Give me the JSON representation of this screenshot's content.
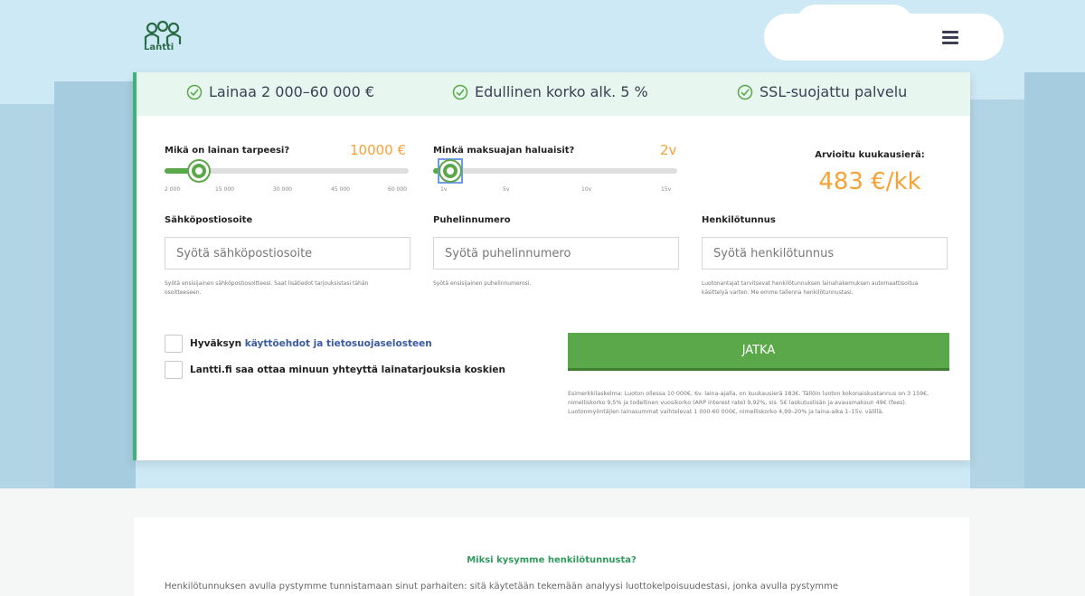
{
  "brand": {
    "name": "Lantti"
  },
  "benefits": [
    {
      "label": "Lainaa 2 000–60 000 €",
      "icon": "check-circle-icon"
    },
    {
      "label": "Edullinen korko alk. 5 %",
      "icon": "check-circle-icon"
    },
    {
      "label": "SSL-suojattu palvelu",
      "icon": "check-circle-icon"
    }
  ],
  "loan_amount": {
    "label": "Mikä on lainan tarpeesi?",
    "value": "10000 €",
    "fraction": 0.14,
    "ticks": [
      "2 000",
      "15 000",
      "30 000",
      "45 000",
      "60 000"
    ]
  },
  "loan_period": {
    "label": "Minkä maksuajan haluaisit?",
    "value": "2v",
    "fraction": 0.07,
    "ticks": [
      "1v",
      "5v",
      "10v",
      "15v"
    ]
  },
  "estimate": {
    "label": "Arvioitu kuukausierä:",
    "value": "483 €/kk"
  },
  "fields": {
    "email": {
      "label": "Sähköpostiosoite",
      "placeholder": "Syötä sähköpostiosoite",
      "help": "Syötä ensisijainen sähköpostiosoitteesi. Saat lisätiedot tarjouksistasi tähän osoitteeseen."
    },
    "phone": {
      "label": "Puhelinnumero",
      "placeholder": "Syötä puhelinnumero",
      "help": "Syötä ensisijainen puhelinnumerosi."
    },
    "ssn": {
      "label": "Henkilötunnus",
      "placeholder": "Syötä henkilötunnus",
      "help": "Luotonantajat tarvitsevat henkilötunnuksen lainahakemuksen automaattisoitua käsittelyä varten. Me emme tallenna henkilötunnustasi."
    }
  },
  "consents": {
    "terms_prefix": "Hyväksyn",
    "terms_link": "käyttöehdot ja tietosuojaselosteen",
    "contact": "Lantti.fi saa ottaa minuun yhteyttä lainatarjouksia koskien"
  },
  "submit": {
    "label": "JATKA"
  },
  "example_text": "Esimerkkilaskelma: Luoton ollessa 10 000€, 6v. laina-ajalla, on kuukausierä 183€. Tällöin luoton kokonaiskustannus on 3 159€, nimelliskorko 9,5% ja todellinen vuosikorko (ARP interest rate) 9,92%, sis. 5€ laskutuslisän ja avausmaksun 49€ (fees). Luotonmyöntäjien lainasummat vaihtelevat 1 000-60 000€, nimelliskorko 4,99–20% ja laina-aika 1–15v. välillä.",
  "info": {
    "title": "Miksi kysymme henkilötunnusta?",
    "text": "Henkilötunnuksen avulla pystymme tunnistamaan sinut parhaiten: sitä käytetään tekemään analyysi luottokelpoisuudestasi, jonka avulla pystymme"
  },
  "colors": {
    "accent": "#5aa84a",
    "orange": "#f7a235",
    "benefit_bg": "#e7f6ef"
  }
}
